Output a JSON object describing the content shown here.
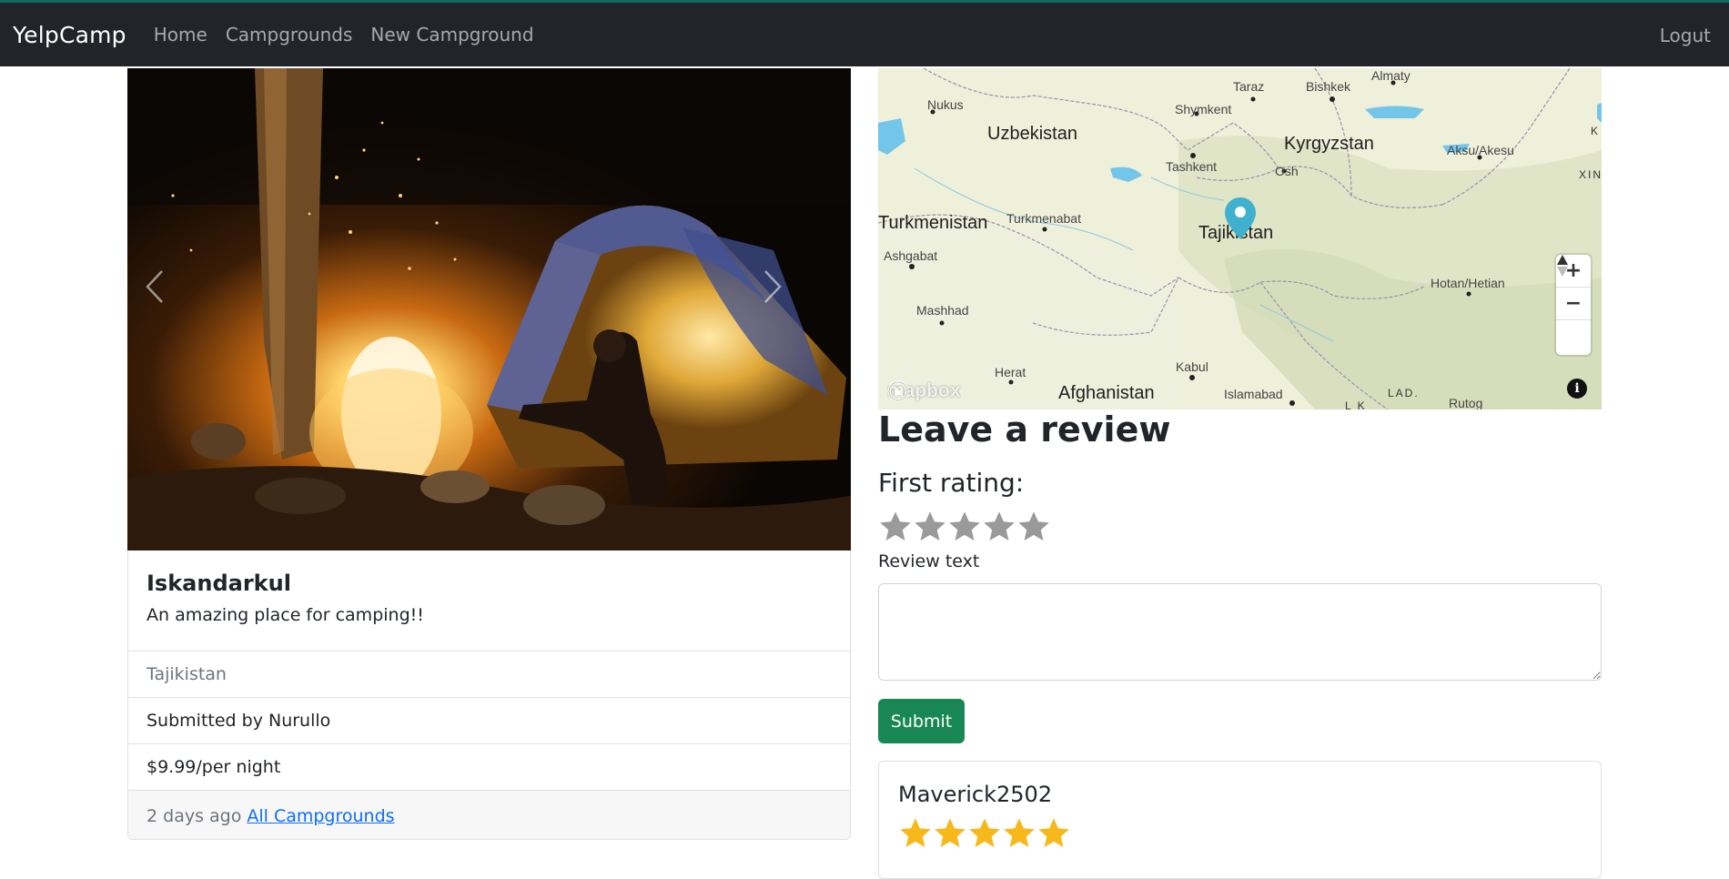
{
  "navbar": {
    "brand": "YelpCamp",
    "links": [
      "Home",
      "Campgrounds",
      "New Campground"
    ],
    "logout": "Logut"
  },
  "campground": {
    "title": "Iskandarkul",
    "description": "An amazing place for camping!!",
    "location": "Tajikistan",
    "submitted_by": "Submitted by Nurullo",
    "price": "$9.99/per night",
    "posted": "2 days ago",
    "all_link": "All Campgrounds"
  },
  "map": {
    "countries": {
      "uzbekistan": "Uzbekistan",
      "kyrgyzstan": "Kyrgyzstan",
      "turkmenistan": "Turkmenistan",
      "tajikistan": "Tajikistan",
      "afghanistan": "Afghanistan"
    },
    "cities": {
      "taraz": "Taraz",
      "bishkek": "Bishkek",
      "almaty": "Almaty",
      "nukus": "Nukus",
      "shymkent": "Shymkent",
      "tashkent": "Tashkent",
      "osh": "Osh",
      "aksu": "Aksu/Akesu",
      "turkmenabat": "Turkmenabat",
      "ashgabat": "Ashgabat",
      "hotan": "Hotan/Hetian",
      "mashhad": "Mashhad",
      "kabul": "Kabul",
      "herat": "Herat",
      "islamabad": "Islamabad",
      "rutog": "Rutog"
    },
    "small_labels": {
      "xin": "XIN",
      "lad": "LAD.",
      "k": "K",
      "lk": "L K"
    },
    "logo": "mapbox",
    "zoom_in": "+",
    "zoom_out": "−",
    "info": "i"
  },
  "review_form": {
    "heading": "Leave a review",
    "rating_legend": "First rating:",
    "text_label": "Review text",
    "submit": "Submit"
  },
  "reviews": [
    {
      "author": "Maverick2502",
      "rating": 5
    }
  ],
  "colors": {
    "navbar_bg": "#212529",
    "submit_green": "#198754",
    "star_gold": "#f7b81c",
    "star_empty": "#9a9a9a",
    "marker": "#3fb1ce"
  }
}
